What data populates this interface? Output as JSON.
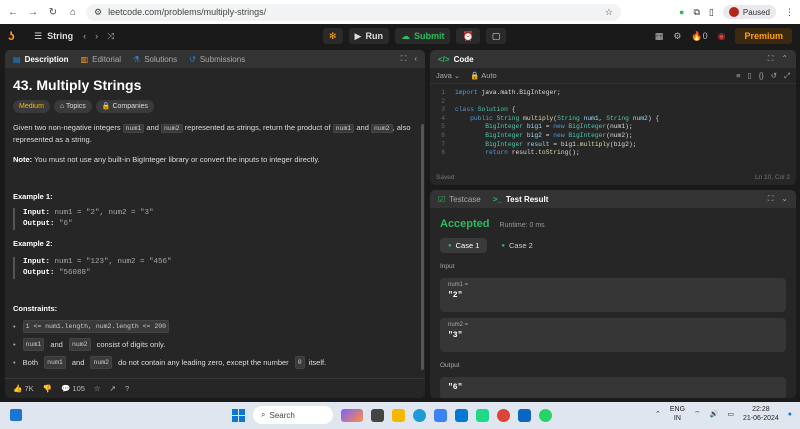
{
  "browser": {
    "url": "leetcode.com/problems/multiply-strings/",
    "profile_status": "Paused"
  },
  "nav": {
    "list_label": "String",
    "run_label": "Run",
    "submit_label": "Submit",
    "streak_count": "0",
    "premium_label": "Premium"
  },
  "description": {
    "tabs": [
      "Description",
      "Editorial",
      "Solutions",
      "Submissions"
    ],
    "title": "43. Multiply Strings",
    "difficulty": "Medium",
    "topics_label": "Topics",
    "companies_label": "Companies",
    "statement_parts": [
      "Given two non-negative integers ",
      "num1",
      " and ",
      "num2",
      " represented as strings, return the product of ",
      "num1",
      " and ",
      "num2",
      ", also represented as a string."
    ],
    "note_label": "Note:",
    "note_text": " You must not use any built-in BigInteger library or convert the inputs to integer directly.",
    "examples": [
      {
        "title": "Example 1:",
        "input_label": "Input:",
        "input": " num1 = \"2\", num2 = \"3\"",
        "output_label": "Output:",
        "output": " \"6\""
      },
      {
        "title": "Example 2:",
        "input_label": "Input:",
        "input": " num1 = \"123\", num2 = \"456\"",
        "output_label": "Output:",
        "output": " \"56088\""
      }
    ],
    "constraints_title": "Constraints:",
    "constraint1": "1 <= num1.length, num2.length <= 200",
    "constraint2_code1": "num1",
    "constraint2_mid": " and ",
    "constraint2_code2": "num2",
    "constraint2_text": " consist of digits only.",
    "constraint3_pre": "Both ",
    "constraint3_code1": "num1",
    "constraint3_mid": " and ",
    "constraint3_code2": "num2",
    "constraint3_text": " do not contain any leading zero, except the number ",
    "constraint3_code3": "0",
    "constraint3_end": " itself.",
    "likes": "7K",
    "comments": "105"
  },
  "code_panel": {
    "title": "Code",
    "language": "Java",
    "auto_label": "Auto",
    "status_left": "Saved",
    "status_right": "Ln 10, Col 2"
  },
  "result_panel": {
    "tab_testcase": "Testcase",
    "tab_result": "Test Result",
    "verdict": "Accepted",
    "runtime": "Runtime: 0 ms",
    "case1": "Case 1",
    "case2": "Case 2",
    "input_label": "Input",
    "param1_name": "num1 =",
    "param1_value": "\"2\"",
    "param2_name": "num2 =",
    "param2_value": "\"3\"",
    "output_label": "Output",
    "output_value": "\"6\""
  },
  "taskbar": {
    "search_label": "Search",
    "lang_line1": "ENG",
    "lang_line2": "IN",
    "time": "22:28",
    "date": "21-06-2024"
  },
  "colors": {
    "accent_orange": "#ffa116",
    "accepted_green": "#2cbb5d",
    "medium_yellow": "#ffb800"
  }
}
